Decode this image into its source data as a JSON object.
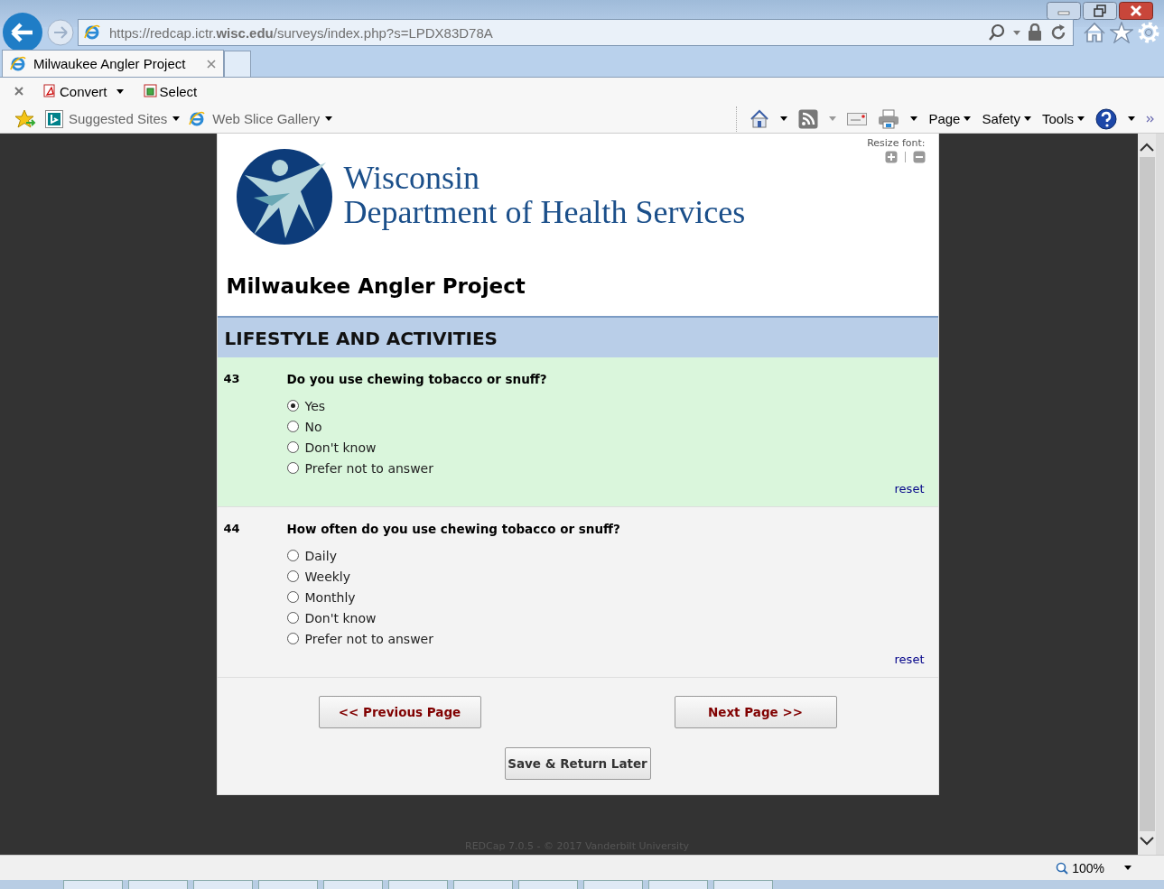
{
  "browser": {
    "address": "https://redcap.ictr.**wisc.edu**/surveys/index.php?s=LPDX83D78A",
    "tabs": [
      {
        "label": "Milwaukee Angler Project",
        "selected": true
      }
    ],
    "command_bar": [
      {
        "label": "Convert",
        "dropdown": true
      },
      {
        "label": "Select",
        "dropdown": false
      }
    ],
    "favorites": [
      {
        "label": "Suggested Sites",
        "kind": "bing"
      },
      {
        "label": "Web Slice Gallery",
        "kind": "ie"
      }
    ],
    "menus": [
      "Page",
      "Safety",
      "Tools"
    ]
  },
  "page": {
    "resize_font_label": "Resize font:",
    "org_name": [
      "Wisconsin",
      "Department of Health Services"
    ],
    "survey_title": "Milwaukee Angler Project",
    "section": "LIFESTYLE AND ACTIVITIES",
    "questions": [
      {
        "number": "43",
        "text": "Do you use chewing tobacco or snuff?",
        "answered": true,
        "options": [
          {
            "label": "Yes",
            "selected": true
          },
          {
            "label": "No",
            "selected": false
          },
          {
            "label": "Don't know",
            "selected": false
          },
          {
            "label": "Prefer not to answer",
            "selected": false
          }
        ],
        "reset": "reset"
      },
      {
        "number": "44",
        "text": "How often do you use chewing tobacco or snuff?",
        "answered": false,
        "options": [
          {
            "label": "Daily",
            "selected": false
          },
          {
            "label": "Weekly",
            "selected": false
          },
          {
            "label": "Monthly",
            "selected": false
          },
          {
            "label": "Don't know",
            "selected": false
          },
          {
            "label": "Prefer not to answer",
            "selected": false
          }
        ],
        "reset": "reset"
      }
    ],
    "nav_buttons": [
      "<< Previous Page",
      "Next Page >>"
    ],
    "save_button": "Save & Return Later",
    "footer": "REDCap 7.0.5 - © 2017 Vanderbilt University"
  },
  "status_bar": {
    "zoom": "100%"
  }
}
